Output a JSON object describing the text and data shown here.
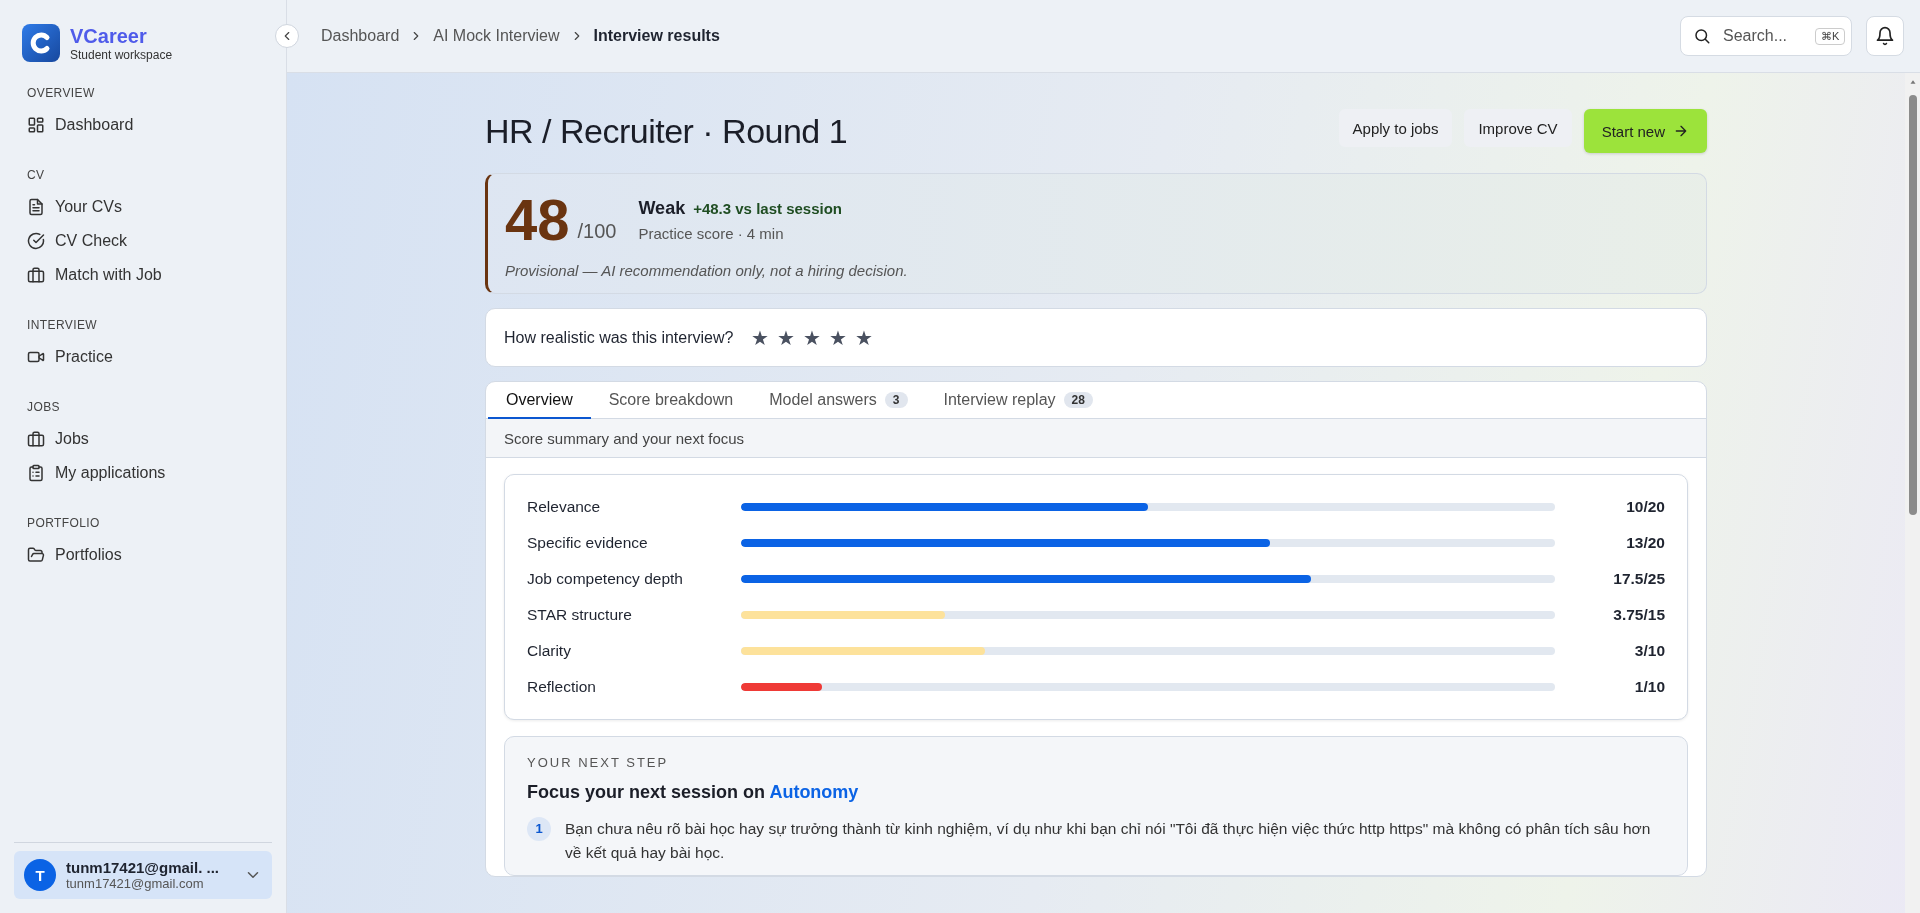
{
  "sidebar": {
    "brand": {
      "name": "VCareer",
      "subtitle": "Student workspace"
    },
    "sections": [
      {
        "heading": "OVERVIEW",
        "items": [
          {
            "label": "Dashboard",
            "selected": false
          }
        ]
      },
      {
        "heading": "CV",
        "items": [
          {
            "label": "Your CVs",
            "selected": false
          },
          {
            "label": "CV Check",
            "selected": false
          },
          {
            "label": "Match with Job",
            "selected": false
          }
        ]
      },
      {
        "heading": "INTERVIEW",
        "items": [
          {
            "label": "Practice",
            "selected": false
          }
        ]
      },
      {
        "heading": "JOBS",
        "items": [
          {
            "label": "Jobs",
            "selected": false
          },
          {
            "label": "My applications",
            "selected": false
          }
        ]
      },
      {
        "heading": "PORTFOLIO",
        "items": [
          {
            "label": "Portfolios",
            "selected": false
          }
        ]
      }
    ],
    "user": {
      "initial": "T",
      "name": "tunm17421@gmail. ...",
      "email": "tunm17421@gmail.com"
    }
  },
  "header": {
    "breadcrumbs": [
      "Dashboard",
      "AI Mock Interview",
      "Interview results"
    ],
    "search": {
      "placeholder": "Search...",
      "shortcut": "⌘K"
    }
  },
  "page": {
    "title": "HR / Recruiter · Round 1",
    "actions": [
      {
        "label": "Apply to jobs",
        "kind": "secondary"
      },
      {
        "label": "Improve CV",
        "kind": "secondary"
      },
      {
        "label": "Start new",
        "kind": "primary"
      }
    ],
    "score": {
      "value": "48",
      "max": "/100",
      "verdict": "Weak",
      "delta": "+48.3 vs last session",
      "meta": "Practice score · 4 min",
      "note": "Provisional — AI recommendation only, not a hiring decision."
    },
    "rating": {
      "question": "How realistic was this interview?",
      "stars": 5
    },
    "tabs": [
      {
        "label": "Overview",
        "selected": true
      },
      {
        "label": "Score breakdown",
        "selected": false
      },
      {
        "label": "Model answers",
        "count": "3",
        "selected": false
      },
      {
        "label": "Interview replay",
        "count": "28",
        "selected": false
      }
    ],
    "tab_caption": "Score summary and your next focus",
    "criteria": [
      {
        "name": "Relevance",
        "level": 0.5,
        "reading": "10/20",
        "color": "#0b63e5"
      },
      {
        "name": "Specific evidence",
        "level": 0.65,
        "reading": "13/20",
        "color": "#0b63e5"
      },
      {
        "name": "Job competency depth",
        "level": 0.7,
        "reading": "17.5/25",
        "color": "#0b63e5"
      },
      {
        "name": "STAR structure",
        "level": 0.25,
        "reading": "3.75/15",
        "color": "#fde29b"
      },
      {
        "name": "Clarity",
        "level": 0.3,
        "reading": "3/10",
        "color": "#fde29b"
      },
      {
        "name": "Reflection",
        "level": 0.1,
        "reading": "1/10",
        "color": "#ef3a36"
      }
    ],
    "next_step": {
      "eyebrow": "YOUR NEXT STEP",
      "heading": "Focus your next session on",
      "focus": "Autonomy",
      "items": [
        {
          "number": "1",
          "text": "Bạn chưa nêu rõ bài học hay sự trưởng thành từ kinh nghiệm, ví dụ như khi bạn chỉ nói \"Tôi đã thực hiện việc thức http https\" mà không có phân tích sâu hơn về kết quả hay bài học."
        }
      ]
    }
  }
}
